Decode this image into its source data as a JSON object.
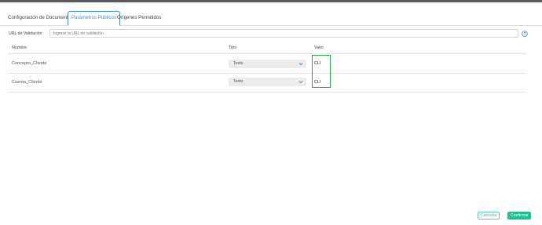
{
  "tabs": [
    {
      "label": "Configuración de Documento",
      "active": false
    },
    {
      "label": "Parámetros Públicos",
      "active": true
    },
    {
      "label": "Orígenes Permitidos",
      "active": false
    }
  ],
  "url": {
    "label": "URL de Validación",
    "placeholder": "Ingrese la URL de validación",
    "help_icon": "question-circle-icon"
  },
  "table": {
    "headers": {
      "nombre": "Nombre",
      "tipo": "Tipo",
      "valor": "Valor"
    },
    "rows": [
      {
        "nombre": "Concepto_Cliente",
        "tipo": "Texto",
        "valor": "CLI"
      },
      {
        "nombre": "Cuenta_Cliente",
        "tipo": "Texto",
        "valor": "CLI"
      }
    ]
  },
  "buttons": {
    "cancel": "Cancelar",
    "confirm": "Confirmar"
  },
  "colors": {
    "accent": "#3b8fd9",
    "confirm": "#1fbf8f",
    "highlight": "#2aa34a"
  }
}
